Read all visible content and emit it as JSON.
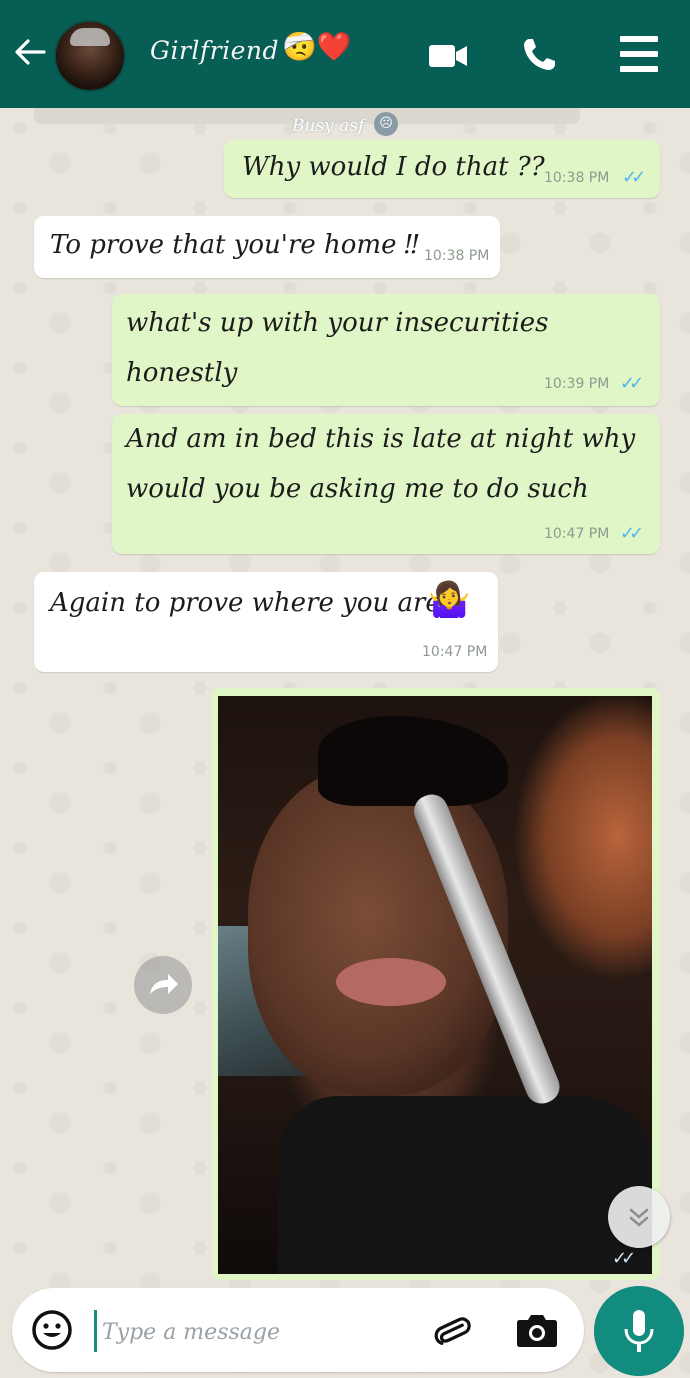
{
  "header": {
    "title": "Girlfriend",
    "title_emojis": "🤕❤️",
    "status": "Busy asf",
    "status_icon": "Busy asf-icon",
    "icons": [
      "back-arrow-icon",
      "video-call-icon",
      "phone-icon",
      "menu-icon"
    ]
  },
  "messages": [
    {
      "dir": "out",
      "text": "Why would I do that ??",
      "time": "10:38 PM",
      "ticks": "✓✓"
    },
    {
      "dir": "in",
      "text": "To prove that you're home ‼",
      "time": "10:38 PM"
    },
    {
      "dir": "out",
      "text": "what's up with your insecurities\nhonestly",
      "time": "10:39 PM",
      "ticks": "✓✓"
    },
    {
      "dir": "out",
      "text": "And am in bed this is late at night why\nwould you be asking me to do such",
      "time": "10:47 PM",
      "ticks": "✓✓"
    },
    {
      "dir": "in",
      "text": "Again to prove where you are",
      "emoji": "🤷‍♀️",
      "time": "10:47 PM"
    }
  ],
  "photo_message": {
    "ticks": "✓✓"
  },
  "input": {
    "placeholder": "Type a message"
  },
  "colors": {
    "header": "#075e54",
    "outgoing": "#e0f6c6",
    "incoming": "#ffffff",
    "mic": "#128c7e",
    "ticks": "#4fb6ec"
  }
}
